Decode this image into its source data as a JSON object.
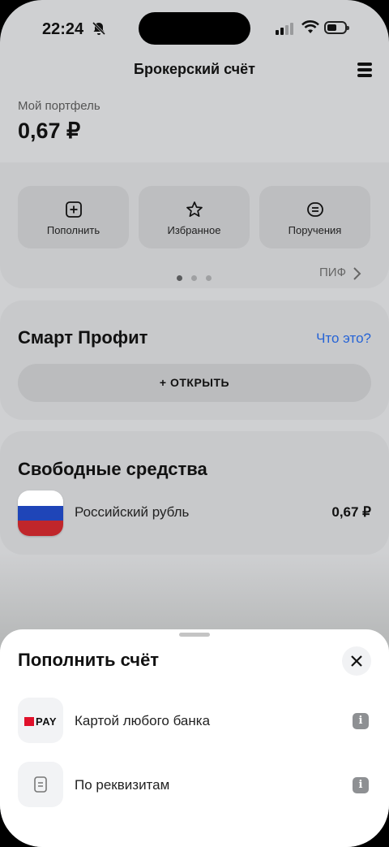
{
  "status_bar": {
    "time": "22:24"
  },
  "header": {
    "title": "Брокерский счёт"
  },
  "portfolio": {
    "label": "Мой портфель",
    "value": "0,67 ₽"
  },
  "actions": [
    {
      "label": "Пополнить",
      "icon": "plus-square-icon"
    },
    {
      "label": "Избранное",
      "icon": "star-icon"
    },
    {
      "label": "Поручения",
      "icon": "list-icon"
    }
  ],
  "carousel": {
    "pages": 3,
    "active": 0,
    "next_label": "ПИФ"
  },
  "smart_profit": {
    "title": "Смарт Профит",
    "what_link": "Что это?",
    "open_button": "+ ОТКРЫТЬ"
  },
  "free_funds": {
    "title": "Свободные средства",
    "items": [
      {
        "name": "Российский рубль",
        "amount": "0,67 ₽",
        "icon": "russia-flag-icon"
      }
    ]
  },
  "sheet": {
    "title": "Пополнить счёт",
    "options": [
      {
        "label": "Картой любого банка",
        "icon": "pay-logo-icon",
        "logo_text": "PAY"
      },
      {
        "label": "По реквизитам",
        "icon": "document-icon"
      }
    ]
  },
  "colors": {
    "accent_link": "#2563d6",
    "pay_red": "#e0112b",
    "flag_white": "#ffffff",
    "flag_blue": "#1f45b8",
    "flag_red": "#c0262b"
  }
}
